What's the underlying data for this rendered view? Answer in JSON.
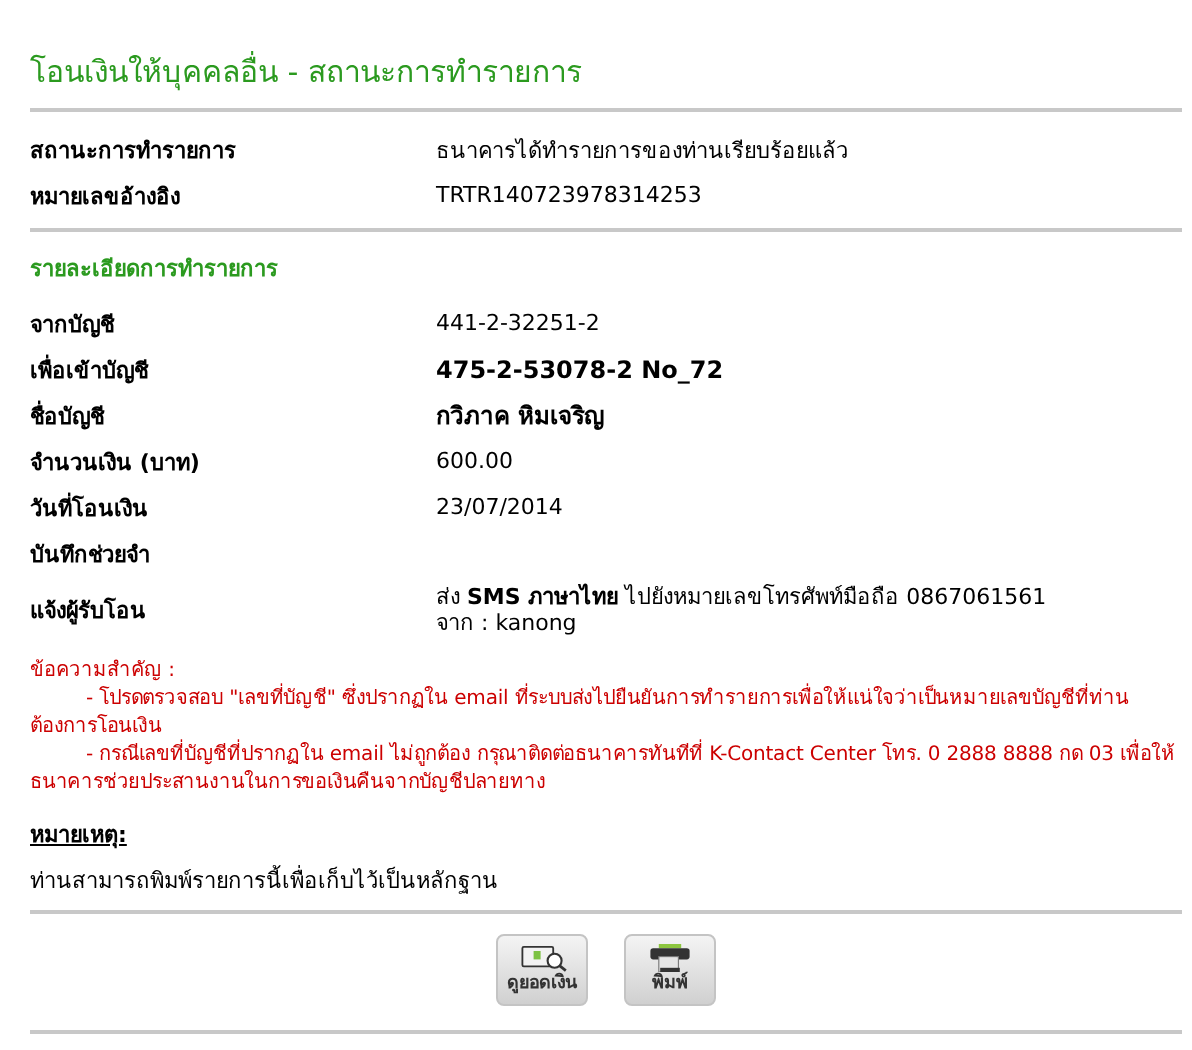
{
  "title": "โอนเงินให้บุคคลอื่น - สถานะการทำรายการ",
  "status_rows": [
    {
      "label": "สถานะการทำรายการ",
      "value": "ธนาคารได้ทำรายการของท่านเรียบร้อยแล้ว"
    },
    {
      "label": "หมายเลขอ้างอิง",
      "value": "TRTR140723978314253"
    }
  ],
  "section_title": "รายละเอียดการทำรายการ",
  "detail_rows": [
    {
      "label": "จากบัญชี",
      "value": "441-2-32251-2"
    },
    {
      "label": "เพื่อเข้าบัญชี",
      "value": "475-2-53078-2 No_72",
      "bold": true
    },
    {
      "label": "ชื่อบัญชี",
      "value": "กวิภาค หิมเจริญ",
      "bold": true
    },
    {
      "label": "จำนวนเงิน (บาท)",
      "value": "600.00"
    },
    {
      "label": "วันที่โอนเงิน",
      "value": "23/07/2014"
    },
    {
      "label": "บันทึกช่วยจำ"
    }
  ],
  "notify": {
    "label": "แจ้งผู้รับโอน",
    "lines": [
      "ส่ง **SMS ภาษาไทย** ไปยังหมายเลขโทรศัพท์มือถือ 0867061561",
      "จาก : kanong"
    ]
  },
  "important": {
    "heading": "ข้อความสำคัญ :",
    "items": [
      "- โปรดตรวจสอบ \"เลขที่บัญชี\" ซึ่งปรากฏใน email ที่ระบบส่งไปยืนยันการทำรายการเพื่อให้แน่ใจว่าเป็นหมายเลขบัญชีที่ท่านต้องการโอนเงิน",
      "- กรณีเลขที่บัญชีที่ปรากฏใน email ไม่ถูกต้อง กรุณาติดต่อธนาคารทันทีที่ K-Contact Center โทร. 0 2888 8888 กด 03 เพื่อให้ธนาคารช่วยประสานงานในการขอเงินคืนจากบัญชีปลายทาง"
    ]
  },
  "note": {
    "heading": "หมายเหตุ:",
    "text": "ท่านสามารถพิมพ์รายการนี้เพื่อเก็บไว้เป็นหลักฐาน"
  },
  "buttons": [
    {
      "label": "ดูยอดเงิน",
      "kind": "balance"
    },
    {
      "label": "พิมพ์",
      "kind": "print"
    }
  ]
}
